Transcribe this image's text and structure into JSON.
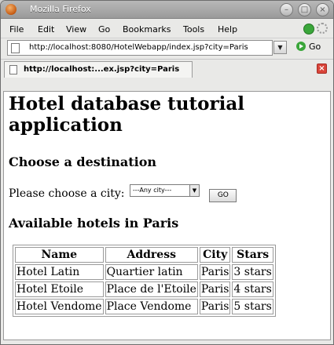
{
  "window": {
    "title": "Mozilla Firefox"
  },
  "menu": [
    "File",
    "Edit",
    "View",
    "Go",
    "Bookmarks",
    "Tools",
    "Help"
  ],
  "nav": {
    "url": "http://localhost:8080/HotelWebapp/index.jsp?city=Paris",
    "go_label": "Go"
  },
  "tab": {
    "label": "http://localhost:...ex.jsp?city=Paris"
  },
  "page": {
    "title": "Hotel database tutorial application",
    "choose_heading": "Choose a destination",
    "city_prompt": "Please choose a city:",
    "city_select_value": "---Any city---",
    "go_button": "GO",
    "available_heading": "Available hotels in Paris",
    "table": {
      "headers": [
        "Name",
        "Address",
        "City",
        "Stars"
      ],
      "rows": [
        [
          "Hotel Latin",
          "Quartier latin",
          "Paris",
          "3 stars"
        ],
        [
          "Hotel Etoile",
          "Place de l'Etoile",
          "Paris",
          "4 stars"
        ],
        [
          "Hotel Vendome",
          "Place Vendome",
          "Paris",
          "5 stars"
        ]
      ]
    }
  }
}
